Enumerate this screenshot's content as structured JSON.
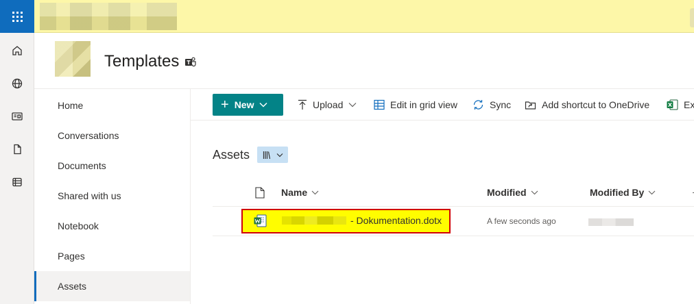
{
  "site": {
    "title": "Templates"
  },
  "nav": {
    "items": [
      {
        "label": "Home"
      },
      {
        "label": "Conversations"
      },
      {
        "label": "Documents"
      },
      {
        "label": "Shared with us"
      },
      {
        "label": "Notebook"
      },
      {
        "label": "Pages"
      },
      {
        "label": "Assets",
        "selected": true
      }
    ]
  },
  "command_bar": {
    "new_label": "New",
    "upload_label": "Upload",
    "grid_view_label": "Edit in grid view",
    "sync_label": "Sync",
    "shortcut_label": "Add shortcut to OneDrive",
    "export_label": "Ex"
  },
  "library": {
    "title": "Assets",
    "columns": {
      "name": "Name",
      "modified": "Modified",
      "modified_by": "Modified By"
    },
    "files": [
      {
        "name_suffix": "- Dokumentation.dotx",
        "modified": "A few seconds ago",
        "icon": "word-template-icon"
      }
    ]
  },
  "colors": {
    "accent": "#038387",
    "waffle": "#0f6cbd",
    "suite_bar": "#fdf7a8",
    "highlight_fill": "#fffd00",
    "highlight_border": "#d00000",
    "view_switch": "#c7e0f4"
  },
  "icons": {
    "rail": [
      "home-icon",
      "globe-icon",
      "news-icon",
      "document-icon",
      "lists-icon"
    ],
    "commands": [
      "upload-icon",
      "grid-view-icon",
      "sync-icon",
      "shortcut-icon",
      "excel-icon"
    ]
  }
}
